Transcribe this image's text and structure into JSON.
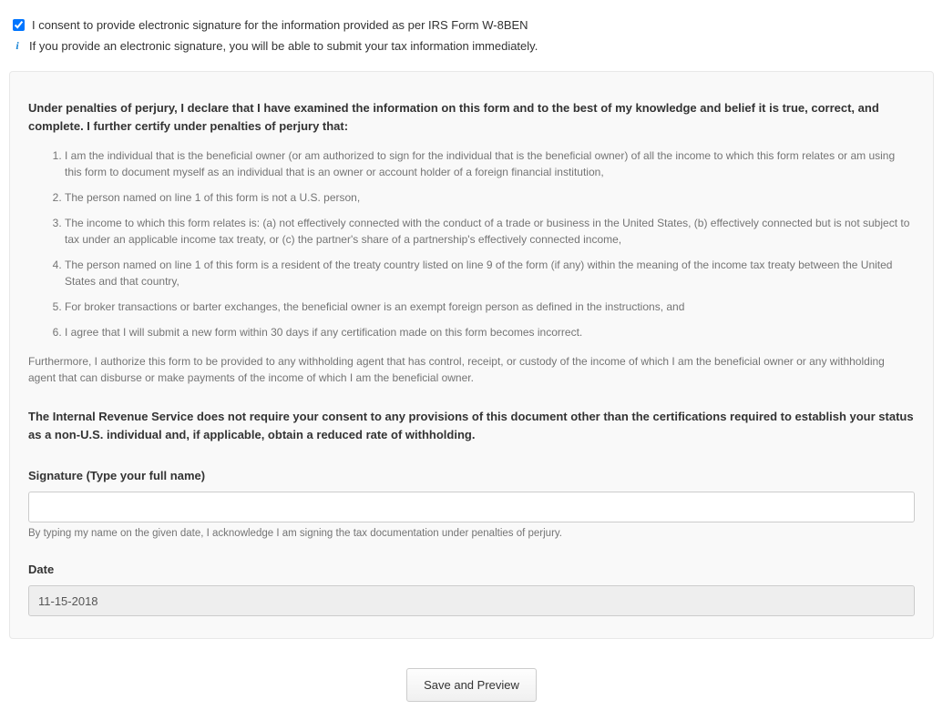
{
  "consent": {
    "checkbox_label": "I consent to provide electronic signature for the information provided as per IRS Form W-8BEN",
    "checked": true
  },
  "info": {
    "text": "If you provide an electronic signature, you will be able to submit your tax information immediately."
  },
  "declaration": "Under penalties of perjury, I declare that I have examined the information on this form and to the best of my knowledge and belief it is true, correct, and complete. I further certify under penalties of perjury that:",
  "certifications": [
    "I am the individual that is the beneficial owner (or am authorized to sign for the individual that is the beneficial owner) of all the income to which this form relates or am using this form to document myself as an individual that is an owner or account holder of a foreign financial institution,",
    "The person named on line 1 of this form is not a U.S. person,",
    "The income to which this form relates is: (a) not effectively connected with the conduct of a trade or business in the United States, (b) effectively connected but is not subject to tax under an applicable income tax treaty, or (c) the partner's share of a partnership's effectively connected income,",
    "The person named on line 1 of this form is a resident of the treaty country listed on line 9 of the form (if any) within the meaning of the income tax treaty between the United States and that country,",
    "For broker transactions or barter exchanges, the beneficial owner is an exempt foreign person as defined in the instructions, and",
    "I agree that I will submit a new form within 30 days if any certification made on this form becomes incorrect."
  ],
  "furthermore": "Furthermore, I authorize this form to be provided to any withholding agent that has control, receipt, or custody of the income of which I am the beneficial owner or any withholding agent that can disburse or make payments of the income of which I am the beneficial owner.",
  "irs_notice": "The Internal Revenue Service does not require your consent to any provisions of this document other than the certifications required to establish your status as a non-U.S. individual and, if applicable, obtain a reduced rate of withholding.",
  "signature": {
    "label": "Signature (Type your full name)",
    "value": "",
    "help": "By typing my name on the given date, I acknowledge I am signing the tax documentation under penalties of perjury."
  },
  "date": {
    "label": "Date",
    "value": "11-15-2018"
  },
  "buttons": {
    "save_preview": "Save and Preview"
  }
}
